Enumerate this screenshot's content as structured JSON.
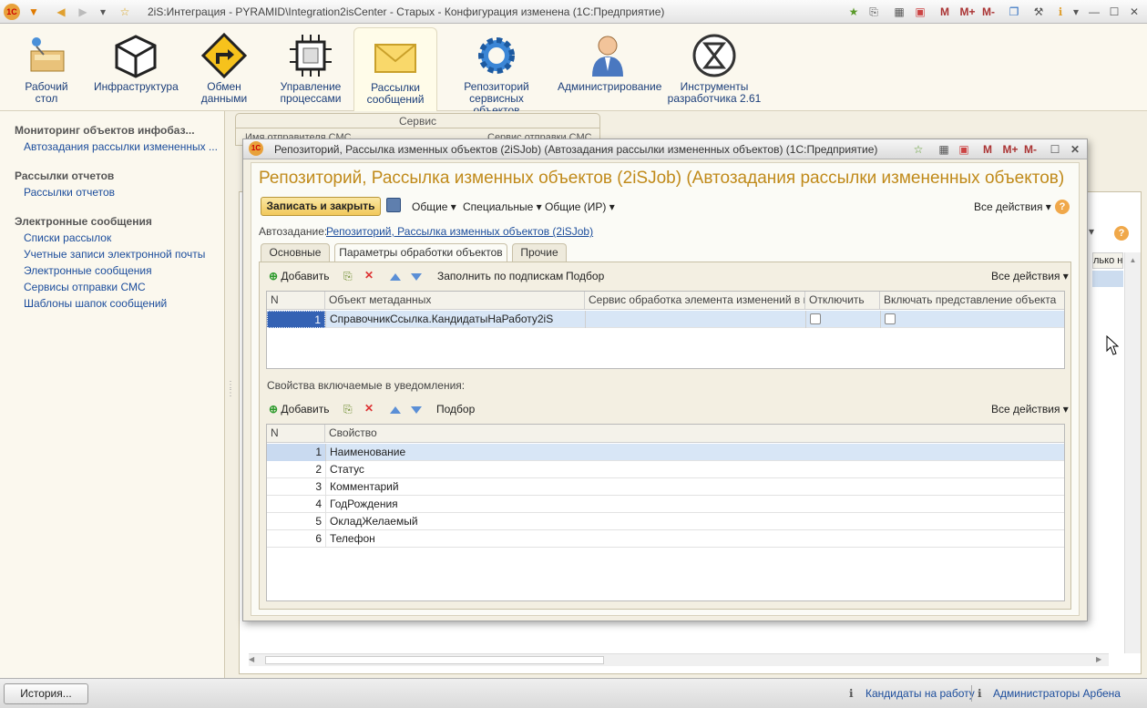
{
  "window": {
    "title": "2iS:Интеграция - PYRAMID\\Integration2isCenter - Старых - Конфигурация изменена  (1С:Предприятие)"
  },
  "sections": [
    {
      "label1": "Рабочий",
      "label2": "стол"
    },
    {
      "label1": "Инфраструктура",
      "label2": ""
    },
    {
      "label1": "Обмен",
      "label2": "данными"
    },
    {
      "label1": "Управление",
      "label2": "процессами"
    },
    {
      "label1": "Рассылки",
      "label2": "сообщений"
    },
    {
      "label1": "Репозиторий",
      "label2": "сервисных объектов"
    },
    {
      "label1": "Администрирование",
      "label2": ""
    },
    {
      "label1": "Инструменты",
      "label2": "разработчика 2.61"
    }
  ],
  "leftpanel": {
    "group1": "Мониторинг объектов инфобаз...",
    "link1": "Автозадания рассылки измененных ...",
    "group2": "Рассылки отчетов",
    "link2": "Рассылки отчетов",
    "group3": "Электронные сообщения",
    "link3": "Списки рассылок",
    "link4": "Учетные записи электронной почты",
    "link5": "Электронные сообщения",
    "link6": "Сервисы отправки СМС",
    "link7": "Шаблоны шапок сообщений"
  },
  "background": {
    "service_header": "Сервис",
    "col1": "Имя отправителя СМС",
    "col2": "Сервис отправки СМС",
    "right_header": "лько но"
  },
  "modal": {
    "window_title": "Репозиторий, Рассылка изменных объектов (2iSJob) (Автозадания рассылки измененных объектов)  (1С:Предприятие)",
    "heading": "Репозиторий, Рассылка изменных объектов (2iSJob) (Автозадания рассылки измененных объектов)",
    "save_close": "Записать и закрыть",
    "menu_general": "Общие",
    "menu_special": "Специальные",
    "menu_general_ir": "Общие (ИР)",
    "all_actions": "Все действия",
    "autojob_label": "Автозадание:",
    "autojob_link": "Репозиторий, Рассылка изменных объектов (2iSJob)",
    "tabs": [
      "Основные",
      "Параметры обработки объектов",
      "Прочие"
    ]
  },
  "table1": {
    "add": "Добавить",
    "fill": "Заполнить по подпискам",
    "pick": "Подбор",
    "all_actions": "Все действия",
    "headers": [
      "N",
      "Объект метаданных",
      "Сервис обработка элемента изменений в и...",
      "Отключить",
      "Включать представление объекта"
    ],
    "rows": [
      {
        "n": "1",
        "object": "СправочникСсылка.КандидатыНаРаботу2iS",
        "service": "",
        "disable": false,
        "include": false
      }
    ]
  },
  "table2": {
    "label": "Свойства включаемые в уведомления:",
    "add": "Добавить",
    "pick": "Подбор",
    "all_actions": "Все действия",
    "headers": [
      "N",
      "Свойство"
    ],
    "rows": [
      {
        "n": "1",
        "prop": "Наименование"
      },
      {
        "n": "2",
        "prop": "Статус"
      },
      {
        "n": "3",
        "prop": "Комментарий"
      },
      {
        "n": "4",
        "prop": "ГодРождения"
      },
      {
        "n": "5",
        "prop": "ОкладЖелаемый"
      },
      {
        "n": "6",
        "prop": "Телефон"
      }
    ]
  },
  "bottombar": {
    "history": "История...",
    "link1": "Кандидаты на работу",
    "link2": "Администраторы Арбена"
  },
  "titlebar_icons": [
    "M",
    "M+",
    "M-"
  ]
}
